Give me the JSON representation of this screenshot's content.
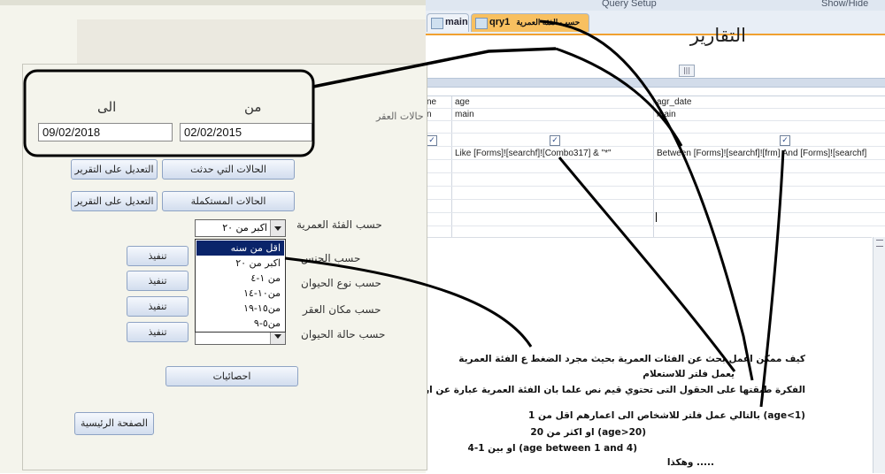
{
  "ribbon": {
    "query_setup": "Query Setup",
    "show_hide": "Show/Hide"
  },
  "tabs": [
    {
      "label": "main"
    },
    {
      "label": "qry1"
    },
    {
      "label": "حسب الفئة العمرية"
    }
  ],
  "grid": {
    "row_head_field": "ne",
    "row_head_table": "n",
    "columns": [
      {
        "field": "age",
        "table": "main",
        "criteria": "Like [Forms]![searchf]![Combo317] & \"*\""
      },
      {
        "field": "agr_date",
        "table": "main",
        "criteria": "Between [Forms]![searchf]![frm] And [Forms]![searchf]"
      }
    ]
  },
  "form": {
    "title": "التقارير",
    "from_label": "من",
    "to_label": "الى",
    "from_value": "02/02/2015",
    "to_value": "09/02/2018",
    "side_label": "حالات العقر",
    "btn_occurred": "الحالات التي حدثت",
    "btn_completed": "الحالات المستكملة",
    "btn_edit_report_1": "التعديل على التقرير",
    "btn_edit_report_2": "التعديل على التقرير",
    "label_age": "حسب الفئة العمرية",
    "label_gender": "حسب الجنس",
    "label_animal_type": "حسب نوع الحيوان",
    "label_place": "حسب مكان العقر",
    "label_animal_status": "حسب حالة الحيوان",
    "age_combo_value": "اكبر من ٢٠",
    "execute_label": "تنفيذ",
    "btn_stats": "احصائيات",
    "btn_home": "الصفحة الرئيسية"
  },
  "dropdown": {
    "options": [
      "اقل من سنه",
      "اكبر من ٢٠",
      "من ١-٤",
      "من١٠-١٤",
      "من١٥-١٩",
      "من٥-٩"
    ],
    "selected_index": 0
  },
  "notes": {
    "line1": "كيف ممكن اعمل بحث عن الفئات العمرية بحيث مجرد الضغط ع الفئة العمرية",
    "line2": "يعمل فلتر للاستعلام",
    "line3": "الفكرة طبقتها على الحقول التى تحتوي قيم نص علما بان الفئة العمرية عبارة عن ارقام",
    "line4": "بالتالي عمل فلتر للاشخاص الى اعمارهم اقل من 1 (age<1)",
    "line5": "او اكثر من 20 (age>20)",
    "line6": "او بين 1-4 (age between 1 and 4)",
    "line7": "وهكذا ....."
  }
}
